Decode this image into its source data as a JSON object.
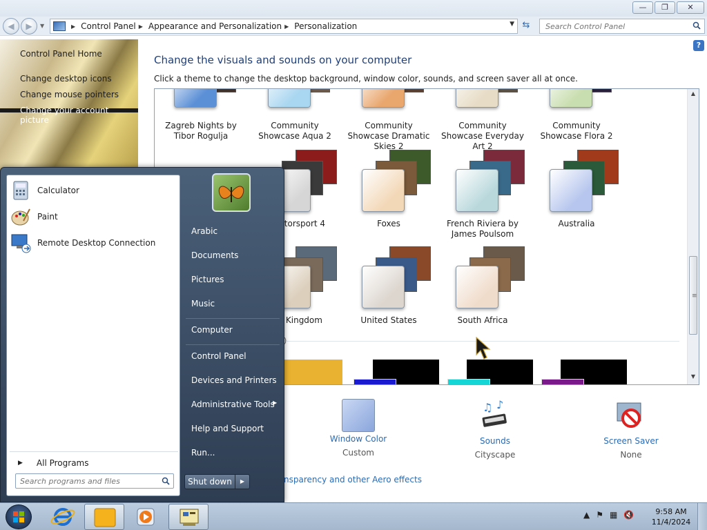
{
  "window": {
    "min_icon": "minimize-icon",
    "max_icon": "maximize-icon",
    "close_icon": "close-icon"
  },
  "navigation": {
    "breadcrumbs": [
      "Control Panel",
      "Appearance and Personalization",
      "Personalization"
    ],
    "search_placeholder": "Search Control Panel"
  },
  "left_pane": {
    "links": [
      "Control Panel Home",
      "Change desktop icons",
      "Change mouse pointers",
      "Change your account picture"
    ]
  },
  "main": {
    "title": "Change the visuals and sounds on your computer",
    "subtitle": "Click a theme to change the desktop background, window color, sounds, and screen saver all at once.",
    "themes_row1": [
      {
        "label": "Zagreb Nights by Tibor Rogulja",
        "color": "#5b8fd6"
      },
      {
        "label": "Community Showcase Aqua 2",
        "color": "#a9d6f0"
      },
      {
        "label": "Community Showcase Dramatic Skies 2",
        "color": "#e9a66d"
      },
      {
        "label": "Community Showcase Everyday Art 2",
        "color": "#e7dcc6"
      },
      {
        "label": "Community Showcase Flora 2",
        "color": "#c9deb0"
      }
    ],
    "themes_row2": [
      {
        "label": "a Motorsport 4",
        "color": "#d6d6d6"
      },
      {
        "label": "Foxes",
        "color": "#f3d8b8"
      },
      {
        "label": "French Riviera by James Poulsom",
        "color": "#b9d8dc"
      },
      {
        "label": "Australia",
        "color": "#b7c6ee"
      }
    ],
    "themes_row3": [
      {
        "label": "ited Kingdom",
        "color": "#dccfbc"
      },
      {
        "label": "United States",
        "color": "#ddd6cf"
      },
      {
        "label": "South Africa",
        "color": "#f0dccb"
      }
    ],
    "group_count": "6)",
    "bottom": [
      {
        "label": "Window Color",
        "value": "Custom",
        "icon": "window-color-icon"
      },
      {
        "label": "Sounds",
        "value": "Cityscape",
        "icon": "sounds-icon"
      },
      {
        "label": "Screen Saver",
        "value": "None",
        "icon": "screen-saver-icon"
      }
    ],
    "aero_link": "nsparency and other Aero effects"
  },
  "start_menu": {
    "programs": [
      {
        "label": "Calculator",
        "icon": "calculator-icon"
      },
      {
        "label": "Paint",
        "icon": "paint-icon"
      },
      {
        "label": "Remote Desktop Connection",
        "icon": "remote-desktop-icon"
      }
    ],
    "all_programs": "All Programs",
    "search_placeholder": "Search programs and files",
    "right_items": [
      "Arabic",
      "Documents",
      "Pictures",
      "Music",
      "Computer",
      "Control Panel",
      "Devices and Printers",
      "Administrative Tools",
      "Help and Support",
      "Run..."
    ],
    "shutdown": "Shut down"
  },
  "taskbar": {
    "time": "9:58 AM",
    "date": "11/4/2024"
  }
}
